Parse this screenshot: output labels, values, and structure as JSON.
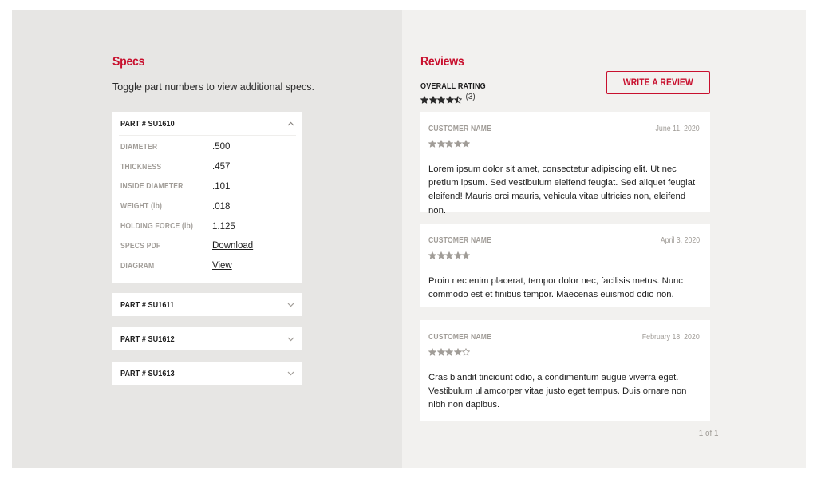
{
  "specs": {
    "title": "Specs",
    "intro": "Toggle part numbers to view additional specs.",
    "parts": [
      {
        "label": "PART # SU1610",
        "expanded": true,
        "toggle_icon": "chevron-up-icon",
        "rows": [
          {
            "label": "DIAMETER",
            "value": ".500",
            "type": "text"
          },
          {
            "label": "THICKNESS",
            "value": ".457",
            "type": "text"
          },
          {
            "label": "INSIDE DIAMETER",
            "value": ".101",
            "type": "text"
          },
          {
            "label": "WEIGHT (lb)",
            "value": ".018",
            "type": "text"
          },
          {
            "label": "HOLDING FORCE (lb)",
            "value": "1.125",
            "type": "text"
          },
          {
            "label": "SPECS PDF",
            "value": "Download",
            "type": "link"
          },
          {
            "label": "DIAGRAM",
            "value": "View",
            "type": "link"
          }
        ]
      },
      {
        "label": "PART # SU1611",
        "expanded": false,
        "toggle_icon": "chevron-down-icon"
      },
      {
        "label": "PART # SU1612",
        "expanded": false,
        "toggle_icon": "chevron-down-icon"
      },
      {
        "label": "PART # SU1613",
        "expanded": false,
        "toggle_icon": "chevron-down-icon"
      }
    ]
  },
  "reviews": {
    "title": "Reviews",
    "overall_label": "OVERALL RATING",
    "overall_rating": 4.5,
    "overall_count": "(3)",
    "write_button": "WRITE A REVIEW",
    "items": [
      {
        "name": "CUSTOMER NAME",
        "date": "June 11, 2020",
        "rating": 5,
        "text": "Lorem ipsum dolor sit amet, consectetur adipiscing elit. Ut nec pretium ipsum. Sed vestibulum eleifend feugiat. Sed aliquet feugiat eleifend! Mauris orci mauris, vehicula vitae ultricies non, eleifend non."
      },
      {
        "name": "CUSTOMER NAME",
        "date": "April 3, 2020",
        "rating": 5,
        "text": "Proin nec enim placerat, tempor dolor nec, facilisis metus. Nunc commodo est et finibus tempor. Maecenas euismod odio non."
      },
      {
        "name": "CUSTOMER NAME",
        "date": "February 18, 2020",
        "rating": 4,
        "text": "Cras blandit tincidunt odio, a condimentum augue viverra eget. Vestibulum ullamcorper vitae justo eget tempus. Duis ornare non nibh non dapibus."
      }
    ],
    "pagination": "1 of 1"
  },
  "colors": {
    "accent": "#c8102e",
    "left_panel_bg": "#e7e6e4",
    "right_panel_bg": "#f2f1ef",
    "muted_text": "#a19d98",
    "overall_star": "#2a2a2a",
    "review_star": "#a19d98"
  }
}
